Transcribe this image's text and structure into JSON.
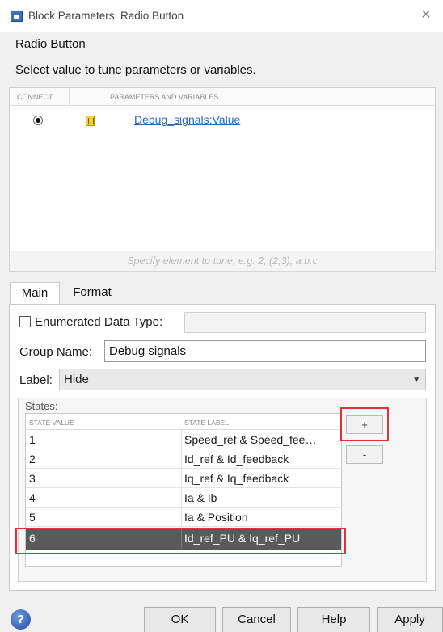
{
  "window": {
    "title": "Block Parameters: Radio Button",
    "close_glyph": "✕"
  },
  "block": {
    "name": "Radio Button",
    "instruction": "Select value to tune parameters or variables."
  },
  "params": {
    "col_connect": "CONNECT",
    "col_params": "PARAMETERS AND VARIABLES",
    "rows": [
      {
        "connected": true,
        "icon": "variable-icon",
        "name": "Debug_signals:Value"
      }
    ],
    "spec_placeholder": "Specify element to tune, e.g. 2, (2,3), a.b.c"
  },
  "tabs": [
    {
      "label": "Main",
      "active": true
    },
    {
      "label": "Format",
      "active": false
    }
  ],
  "main": {
    "enumerated_label": "Enumerated Data Type:",
    "enumerated_checked": false,
    "group_name_label": "Group Name:",
    "group_name_value": "Debug signals",
    "label_label": "Label:",
    "label_value": "Hide",
    "states_title": "States:",
    "col_state_value": "STATE VALUE",
    "col_state_label": "STATE LABEL",
    "states": [
      {
        "value": "1",
        "label": "Speed_ref & Speed_fee…"
      },
      {
        "value": "2",
        "label": "Id_ref & Id_feedback"
      },
      {
        "value": "3",
        "label": "Iq_ref & Iq_feedback"
      },
      {
        "value": "4",
        "label": "Ia & Ib"
      },
      {
        "value": "5",
        "label": "Ia & Position"
      },
      {
        "value": "6",
        "label": "Id_ref_PU & Iq_ref_PU",
        "selected": true
      }
    ],
    "add_label": "+",
    "remove_label": "-"
  },
  "footer": {
    "help_glyph": "?",
    "ok": "OK",
    "cancel": "Cancel",
    "help": "Help",
    "apply": "Apply"
  },
  "colors": {
    "highlight": "#e0323a",
    "selected_row": "#5a5a5a",
    "link": "#2a66b8"
  }
}
